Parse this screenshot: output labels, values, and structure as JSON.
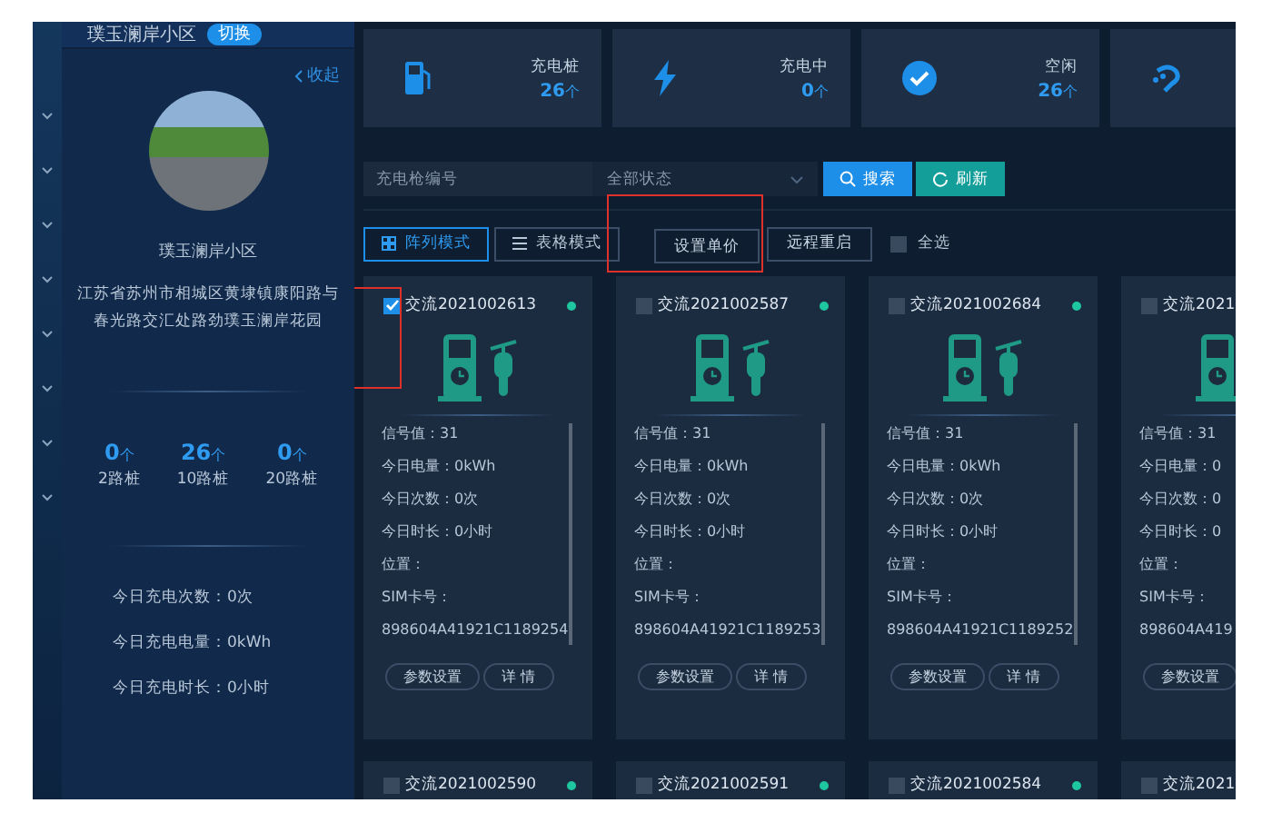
{
  "sidebar": {
    "site_name": "璞玉澜岸小区",
    "switch_button": "切换",
    "collapse_link": "收起",
    "name": "璞玉澜岸小区",
    "address": "江苏省苏州市相城区黄埭镇康阳路与春光路交汇处路劲璞玉澜岸花园",
    "pile_counts": [
      {
        "value": "0",
        "unit": "个",
        "label": "2路桩"
      },
      {
        "value": "26",
        "unit": "个",
        "label": "10路桩"
      },
      {
        "value": "0",
        "unit": "个",
        "label": "20路桩"
      }
    ],
    "today": [
      "今日充电次数：0次",
      "今日充电电量：0kWh",
      "今日充电时长：0小时"
    ]
  },
  "stats": [
    {
      "kind": "pile",
      "label": "充电桩",
      "value": "26",
      "unit": "个"
    },
    {
      "kind": "charging",
      "label": "充电中",
      "value": "0",
      "unit": "个"
    },
    {
      "kind": "idle",
      "label": "空闲",
      "value": "26",
      "unit": "个"
    },
    {
      "kind": "plug"
    }
  ],
  "filters": {
    "code_field": {
      "placeholder": "充电枪编号"
    },
    "status_select": {
      "value": "全部状态"
    },
    "search_button": "搜索",
    "refresh_button": "刷新"
  },
  "toolbar": {
    "view_modes": [
      {
        "label": "阵列模式",
        "selected": true
      },
      {
        "label": "表格模式",
        "selected": false
      }
    ],
    "set_price_button": {
      "label": "设置单价",
      "highlighted": true
    },
    "remote_restart_button": "远程重启",
    "select_all": {
      "label": "全选",
      "checked": false
    }
  },
  "cards": [
    {
      "name": "交流2021002613",
      "checked": true,
      "highlighted": true,
      "lines": [
        "信号值：31",
        "今日电量：0kWh",
        "今日次数：0次",
        "今日时长：0小时",
        "位置：",
        "SIM卡号：",
        "898604A41921C1189254"
      ],
      "buttons": [
        "参数设置",
        "详 情"
      ]
    },
    {
      "name": "交流2021002587",
      "checked": false,
      "highlighted": false,
      "lines": [
        "信号值：31",
        "今日电量：0kWh",
        "今日次数：0次",
        "今日时长：0小时",
        "位置：",
        "SIM卡号：",
        "898604A41921C1189253"
      ],
      "buttons": [
        "参数设置",
        "详 情"
      ]
    },
    {
      "name": "交流2021002684",
      "checked": false,
      "highlighted": false,
      "lines": [
        "信号值：31",
        "今日电量：0kWh",
        "今日次数：0次",
        "今日时长：0小时",
        "位置：",
        "SIM卡号：",
        "898604A41921C1189252"
      ],
      "buttons": [
        "参数设置",
        "详 情"
      ]
    },
    {
      "name": "交流2021",
      "checked": false,
      "highlighted": false,
      "lines": [
        "信号值：31",
        "今日电量：0",
        "今日次数：0",
        "今日时长：0",
        "位置：",
        "SIM卡号：",
        "898604A419"
      ],
      "buttons": [
        "参数设置"
      ]
    },
    {
      "name": "交流2021002590",
      "checked": false,
      "highlighted": false
    },
    {
      "name": "交流2021002591",
      "checked": false,
      "highlighted": false
    },
    {
      "name": "交流2021002584",
      "checked": false,
      "highlighted": false
    },
    {
      "name": "交流2021",
      "checked": false,
      "highlighted": false
    }
  ]
}
